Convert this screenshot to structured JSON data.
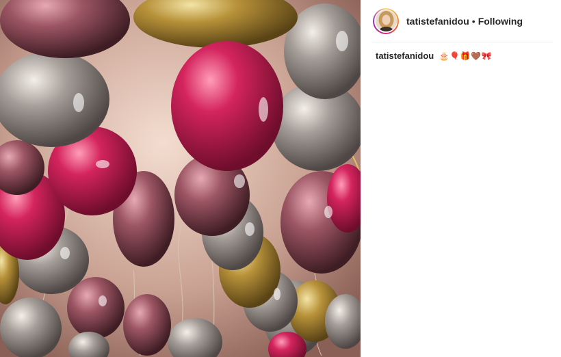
{
  "post": {
    "image_alt": "Metallic balloons floating against a ceiling",
    "colors": {
      "ceiling": "#c49a8a",
      "pink": "#c81d55",
      "silver": "#a9a39e",
      "gold": "#b8923a",
      "rose": "#9c5563"
    }
  },
  "header": {
    "username": "tatistefanidou",
    "separator": "•",
    "follow_state": "Following"
  },
  "caption": {
    "username": "tatistefanidou",
    "text": "🎂🎈🎁🤎🎀"
  }
}
